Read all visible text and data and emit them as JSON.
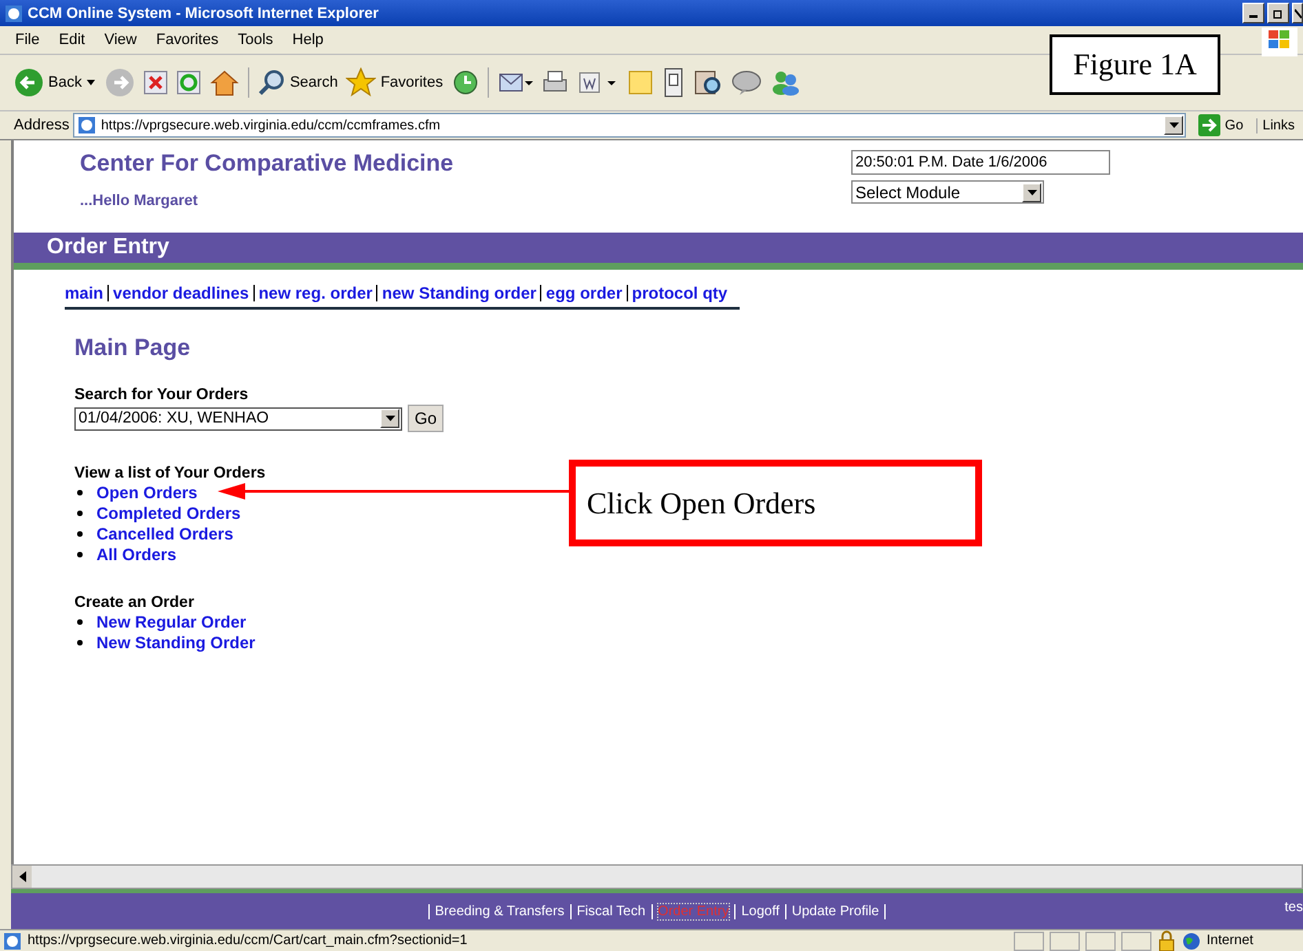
{
  "window": {
    "title": "CCM Online System - Microsoft Internet Explorer"
  },
  "menu": [
    "File",
    "Edit",
    "View",
    "Favorites",
    "Tools",
    "Help"
  ],
  "toolbar": {
    "back": "Back",
    "search": "Search",
    "favorites": "Favorites"
  },
  "address_bar": {
    "label": "Address",
    "value": "https://vprgsecure.web.virginia.edu/ccm/ccmframes.cfm",
    "go": "Go",
    "links": "Links"
  },
  "header": {
    "title": "Center For Comparative Medicine",
    "greeting": "...Hello Margaret",
    "datetime": "20:50:01 P.M. Date 1/6/2006",
    "module_select": "Select Module"
  },
  "section_bar": {
    "title": "Order Entry"
  },
  "nav_links": [
    "main",
    "vendor deadlines",
    "new reg. order",
    "new Standing order",
    "egg order",
    "protocol qty"
  ],
  "main": {
    "heading": "Main Page",
    "search_label": "Search for Your Orders",
    "search_value": "01/04/2006: XU, WENHAO",
    "search_button": "Go",
    "view_label": "View a list of Your Orders",
    "view_links": [
      "Open Orders",
      "Completed Orders",
      "Cancelled Orders",
      "All Orders"
    ],
    "create_label": "Create an Order",
    "create_links": [
      "New Regular Order",
      "New Standing Order"
    ]
  },
  "footer": {
    "links": [
      {
        "label": "Breeding & Transfers",
        "selected": false
      },
      {
        "label": "Fiscal Tech",
        "selected": false
      },
      {
        "label": "Order Entry",
        "selected": true
      },
      {
        "label": "Logoff",
        "selected": false
      },
      {
        "label": "Update Profile",
        "selected": false
      }
    ],
    "edge_text": "tes"
  },
  "status_bar": {
    "url": "https://vprgsecure.web.virginia.edu/ccm/Cart/cart_main.cfm?sectionid=1",
    "zone": "Internet"
  },
  "annotations": {
    "figure_label": "Figure 1A",
    "callout": "Click Open Orders"
  }
}
